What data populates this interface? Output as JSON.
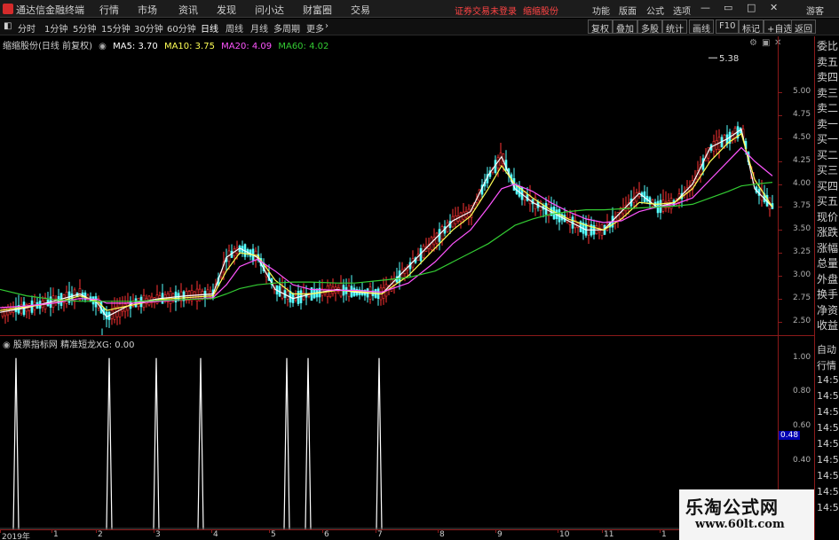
{
  "menubar": {
    "app_title": "通达信金融终端",
    "items": [
      "行情",
      "市场",
      "资讯",
      "发现",
      "问小达",
      "财富圈",
      "交易"
    ],
    "notice": "证券交易未登录",
    "stock_tag": "缩缩股份",
    "right_items": [
      "功能",
      "版面",
      "公式",
      "选项"
    ],
    "guest": "游客"
  },
  "toolbar": {
    "periods": [
      "分时",
      "1分钟",
      "5分钟",
      "15分钟",
      "30分钟",
      "60分钟",
      "日线",
      "周线",
      "月线",
      "多周期",
      "更多"
    ],
    "active_period": "日线",
    "right_buttons": [
      "复权",
      "叠加",
      "多股",
      "统计",
      "画线",
      "F10",
      "标记",
      "+自选",
      "返回"
    ]
  },
  "main_chart": {
    "stock_label": "缩缩股份(日线 前复权)",
    "ma5_label": "MA5: 3.70",
    "ma10_label": "MA10: 3.75",
    "ma20_label": "MA20: 4.09",
    "ma60_label": "MA60: 4.02",
    "high_mark": "5.38",
    "low_mark": "2.18",
    "y_ticks": [
      "5.00",
      "4.75",
      "4.50",
      "4.25",
      "4.00",
      "3.75",
      "3.50",
      "3.25",
      "3.00",
      "2.75",
      "2.50"
    ],
    "colors": {
      "ma5": "#ffffff",
      "ma10": "#ffff55",
      "ma20": "#ff55ff",
      "ma60": "#33cc33",
      "up": "#ff3333",
      "down": "#55ffff"
    }
  },
  "indicator": {
    "label": "股票指标网  精准短龙XG: 0.00",
    "y_ticks": [
      "1.00",
      "0.80",
      "0.60",
      "0.40"
    ],
    "current_value": "0.48"
  },
  "right_panel": {
    "quote_labels": [
      "委比",
      "卖五",
      "卖四",
      "卖三",
      "卖二",
      "卖一",
      "买一",
      "买二",
      "买三",
      "买四",
      "买五",
      "现价",
      "涨跌",
      "涨幅",
      "总量",
      "外盘",
      "换手",
      "净资",
      "收益"
    ],
    "lower_labels": [
      "自动",
      "行情",
      "14:5",
      "14:5",
      "14:5",
      "14:5",
      "14:5",
      "14:5",
      "14:5",
      "14:5",
      "14:5"
    ]
  },
  "x_axis": {
    "labels": [
      "2019年",
      "1",
      "2",
      "3",
      "4",
      "5",
      "6",
      "7",
      "8",
      "9",
      "10",
      "11",
      "1"
    ]
  },
  "watermark": {
    "title": "乐淘公式网",
    "url": "www.60lt.com"
  },
  "chart_data": [
    {
      "type": "line",
      "title": "缩缩股份(日线 前复权)",
      "x": [
        0,
        30,
        60,
        90,
        110,
        120,
        150,
        180,
        210,
        240,
        255,
        270,
        290,
        310,
        330,
        350,
        380,
        400,
        430,
        460,
        490,
        510,
        530,
        550,
        565,
        580,
        600,
        620,
        640,
        660,
        680,
        700,
        720,
        740,
        760,
        780,
        800,
        820,
        835,
        850,
        870
      ],
      "series": [
        {
          "name": "MA5",
          "values": [
            2.6,
            2.65,
            2.72,
            2.8,
            2.7,
            2.55,
            2.7,
            2.75,
            2.78,
            2.8,
            3.2,
            3.3,
            3.2,
            2.85,
            2.75,
            2.8,
            2.85,
            2.82,
            2.8,
            3.1,
            3.4,
            3.6,
            3.7,
            4.1,
            4.3,
            3.95,
            3.8,
            3.7,
            3.6,
            3.5,
            3.5,
            3.7,
            3.9,
            3.75,
            3.8,
            4.0,
            4.4,
            4.5,
            4.6,
            3.95,
            3.75
          ]
        },
        {
          "name": "MA10",
          "values": [
            2.62,
            2.66,
            2.7,
            2.78,
            2.72,
            2.62,
            2.68,
            2.74,
            2.76,
            2.78,
            3.05,
            3.25,
            3.22,
            2.95,
            2.8,
            2.8,
            2.84,
            2.83,
            2.8,
            3.0,
            3.3,
            3.5,
            3.65,
            3.95,
            4.2,
            4.0,
            3.85,
            3.72,
            3.62,
            3.55,
            3.5,
            3.62,
            3.8,
            3.78,
            3.8,
            3.95,
            4.25,
            4.45,
            4.55,
            4.05,
            3.75
          ]
        },
        {
          "name": "MA20",
          "values": [
            2.65,
            2.67,
            2.7,
            2.75,
            2.74,
            2.7,
            2.7,
            2.72,
            2.74,
            2.76,
            2.9,
            3.1,
            3.18,
            3.05,
            2.9,
            2.85,
            2.84,
            2.84,
            2.82,
            2.92,
            3.15,
            3.35,
            3.5,
            3.75,
            3.95,
            4.0,
            3.92,
            3.8,
            3.7,
            3.62,
            3.58,
            3.6,
            3.7,
            3.75,
            3.78,
            3.85,
            4.05,
            4.25,
            4.4,
            4.25,
            4.09
          ]
        },
        {
          "name": "MA60",
          "values": [
            2.85,
            2.78,
            2.74,
            2.72,
            2.72,
            2.72,
            2.72,
            2.73,
            2.74,
            2.75,
            2.8,
            2.86,
            2.9,
            2.92,
            2.93,
            2.93,
            2.92,
            2.92,
            2.95,
            2.98,
            3.05,
            3.15,
            3.25,
            3.35,
            3.45,
            3.55,
            3.62,
            3.67,
            3.7,
            3.72,
            3.72,
            3.73,
            3.74,
            3.75,
            3.76,
            3.78,
            3.85,
            3.92,
            3.98,
            4.0,
            4.02
          ]
        }
      ],
      "ylim": [
        2.35,
        5.45
      ]
    },
    {
      "type": "line",
      "title": "精准短龙XG",
      "spikes_x": [
        18,
        123,
        176,
        226,
        323,
        347,
        427
      ],
      "series": [
        {
          "name": "XG",
          "values": [
            1,
            1,
            1,
            1,
            1,
            1,
            1
          ]
        }
      ],
      "ylim": [
        0,
        1.05
      ]
    }
  ]
}
